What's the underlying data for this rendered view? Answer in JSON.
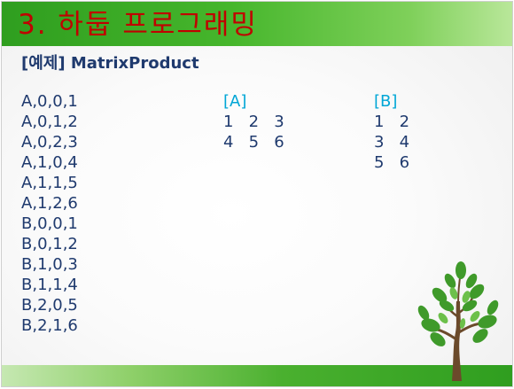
{
  "slide": {
    "title": "3. 하둡 프로그래밍",
    "subtitle": "[예제] MatrixProduct"
  },
  "records": [
    "A,0,0,1",
    "A,0,1,2",
    "A,0,2,3",
    "A,1,0,4",
    "A,1,1,5",
    "A,1,2,6",
    "B,0,0,1",
    "B,0,1,2",
    "B,1,0,3",
    "B,1,1,4",
    "B,2,0,5",
    "B,2,1,6"
  ],
  "matrix_a": {
    "label": "[A]",
    "rows": [
      "1   2   3",
      "4   5   6"
    ]
  },
  "matrix_b": {
    "label": "[B]",
    "rows": [
      "1   2",
      "3   4",
      "5   6"
    ]
  },
  "colors": {
    "title": "#c00000",
    "text": "#1f3a6e",
    "heading": "#00a6d6",
    "bar_green": "#2f9e1f"
  },
  "decor": {
    "icon": "tree-icon"
  }
}
